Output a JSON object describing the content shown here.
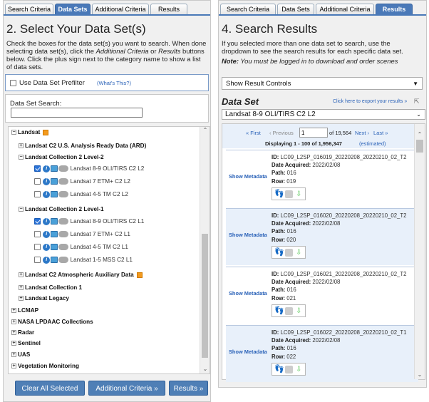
{
  "left": {
    "tabs": [
      "Search Criteria",
      "Data Sets",
      "Additional Criteria",
      "Results"
    ],
    "active_tab": "Data Sets",
    "title": "2. Select Your Data Set(s)",
    "desc_part1": "Check the boxes for the data set(s) you want to search. When done selecting data set(s), click the ",
    "desc_em1": "Additional Criteria",
    "desc_part2": " or ",
    "desc_em2": "Results",
    "desc_part3": " buttons below. Click the plus sign next to the category name to show a list of data sets.",
    "prefilter_label": "Use Data Set Prefilter",
    "prefilter_link": "(What's This?)",
    "search_label": "Data Set Search:",
    "search_value": "",
    "tree": {
      "landsat": "Landsat",
      "ard": "Landsat C2 U.S. Analysis Ready Data (ARD)",
      "c2l2": "Landsat Collection 2 Level-2",
      "c2l2_items": [
        {
          "label": "Landsat 8-9 OLI/TIRS C2 L2",
          "checked": true
        },
        {
          "label": "Landsat 7 ETM+ C2 L2",
          "checked": false
        },
        {
          "label": "Landsat 4-5 TM C2 L2",
          "checked": false
        }
      ],
      "c2l1": "Landsat Collection 2 Level-1",
      "c2l1_items": [
        {
          "label": "Landsat 8-9 OLI/TIRS C2 L1",
          "checked": true
        },
        {
          "label": "Landsat 7 ETM+ C2 L1",
          "checked": false
        },
        {
          "label": "Landsat 4-5 TM C2 L1",
          "checked": false
        },
        {
          "label": "Landsat 1-5 MSS C2 L1",
          "checked": false
        }
      ],
      "aux": "Landsat C2 Atmospheric Auxiliary Data",
      "c1": "Landsat Collection 1",
      "legacy": "Landsat Legacy",
      "top": [
        "LCMAP",
        "NASA LPDAAC Collections",
        "Radar",
        "Sentinel",
        "UAS",
        "Vegetation Monitoring"
      ]
    },
    "buttons": {
      "clear": "Clear All Selected",
      "additional": "Additional Criteria »",
      "results": "Results »"
    }
  },
  "right": {
    "tabs": [
      "Search Criteria",
      "Data Sets",
      "Additional Criteria",
      "Results"
    ],
    "active_tab": "Results",
    "title": "4. Search Results",
    "desc": "If you selected more than one data set to search, use the dropdown to see the search results for each specific data set.",
    "note_label": "Note:",
    "note_text": " You must be logged in to download and order scenes",
    "controls_label": "Show Result Controls",
    "dataset_heading": "Data Set",
    "export_link": "Click here to export your results »",
    "dataset_selected": "Landsat 8-9 OLI/TIRS C2 L2",
    "pager": {
      "first": "« First",
      "prev": "‹ Previous",
      "page": "1",
      "of": "of 19,564",
      "next": "Next ›",
      "last": "Last »"
    },
    "displaying": "Displaying 1 - 100 of 1,956,347",
    "estimated": "(estimated)",
    "show_metadata": "Show Metadata",
    "results": [
      {
        "id": "LC09_L2SP_016019_20220208_20220210_02_T2",
        "date": "2022/02/08",
        "path": "016",
        "row": "019"
      },
      {
        "id": "LC09_L2SP_016020_20220208_20220210_02_T2",
        "date": "2022/02/08",
        "path": "016",
        "row": "020"
      },
      {
        "id": "LC09_L2SP_016021_20220208_20220210_02_T2",
        "date": "2022/02/08",
        "path": "016",
        "row": "021"
      },
      {
        "id": "LC09_L2SP_016022_20220208_20220210_02_T1",
        "date": "2022/02/08",
        "path": "016",
        "row": "022"
      }
    ],
    "labels": {
      "id": "ID:",
      "date": "Date Acquired:",
      "path": "Path:",
      "row": "Row:"
    }
  },
  "colors": {
    "accent": "#4a79b8",
    "button": "#4f7fb6",
    "link": "#2a62b8",
    "badge": "#f39a1e"
  }
}
